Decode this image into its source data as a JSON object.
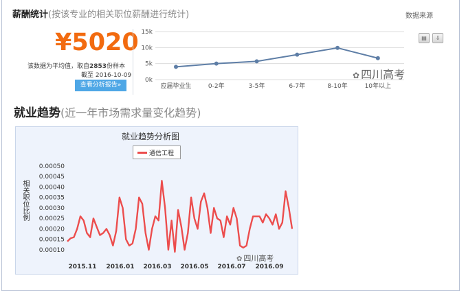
{
  "salary": {
    "title": "薪酬统计",
    "subtitle": "(按该专业的相关职位薪酬进行统计)",
    "data_source": "数据来源",
    "amount": "¥5020",
    "note_prefix": "该数据为平均值，取自",
    "sample_count": "2853",
    "note_suffix": "份样本",
    "date_line": "截至 2016-10-09",
    "report_button": "查看分析报告»",
    "print_icon": "print-icon",
    "download_icon": "download-icon"
  },
  "watermark": {
    "text": "四川高考",
    "bottom_text": "四川高考",
    "logo_icon": "wechat-icon"
  },
  "trend": {
    "title": "就业趋势",
    "subtitle": "(近一年市场需求量变化趋势)",
    "chart_title": "就业趋势分析图",
    "legend": "通信工程",
    "ylabel": "相关职位比例"
  },
  "chart_data": [
    {
      "type": "line",
      "categories": [
        "应届毕业生",
        "0-2年",
        "3-5年",
        "6-7年",
        "8-10年",
        "10年以上"
      ],
      "values": [
        4000,
        5000,
        5700,
        7800,
        9900,
        6700
      ],
      "ylim": [
        0,
        15000
      ],
      "yticks": [
        "0k",
        "5k",
        "10k",
        "15k"
      ],
      "grid": true,
      "color": "#5e7ea6"
    },
    {
      "type": "line",
      "title": "就业趋势分析图",
      "ylabel": "相关职位比例",
      "series": [
        {
          "name": "通信工程",
          "color": "#ec4d4d",
          "values": [
            0.00014,
            0.000155,
            0.00016,
            0.0002,
            0.00026,
            0.00024,
            0.00018,
            0.00016,
            0.00025,
            0.00021,
            0.00017,
            0.00018,
            0.0002,
            0.00017,
            0.00012,
            0.00019,
            0.00035,
            0.0003,
            0.00015,
            0.00012,
            0.00013,
            0.0002,
            0.00035,
            0.00032,
            0.00018,
            0.0001,
            0.0002,
            0.00026,
            0.00024,
            0.00043,
            0.0003,
            0.0001,
            0.00024,
            9e-05,
            0.00029,
            0.00021,
            0.0001,
            0.00018,
            0.00035,
            0.00025,
            0.0002,
            0.00033,
            0.00037,
            0.0003,
            0.00018,
            0.0003,
            0.00025,
            0.00024,
            0.00016,
            0.00026,
            0.00022,
            0.0003,
            0.00025,
            0.00012,
            0.00011,
            0.00012,
            0.0002,
            0.00026,
            0.00026,
            0.00026,
            0.00023,
            0.00027,
            0.00025,
            0.00022,
            0.00027,
            0.0002,
            0.00023,
            0.00038,
            0.0003,
            0.0002
          ]
        }
      ],
      "xticks": [
        "2015.11",
        "2016.01",
        "2016.03",
        "2016.05",
        "2016.07",
        "2016.09"
      ],
      "yticks": [
        "0.00010",
        "0.00015",
        "0.00020",
        "0.00025",
        "0.00030",
        "0.00035",
        "0.00040",
        "0.00045",
        "0.00050"
      ],
      "ylim": [
        8e-05,
        0.0005
      ]
    }
  ]
}
